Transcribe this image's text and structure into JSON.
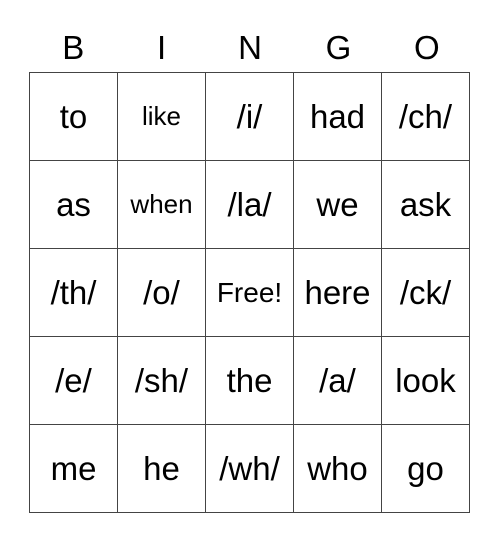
{
  "header": [
    "B",
    "I",
    "N",
    "G",
    "O"
  ],
  "rows": [
    [
      "to",
      "like",
      "/i/",
      "had",
      "/ch/"
    ],
    [
      "as",
      "when",
      "/la/",
      "we",
      "ask"
    ],
    [
      "/th/",
      "/o/",
      "Free!",
      "here",
      "/ck/"
    ],
    [
      "/e/",
      "/sh/",
      "the",
      "/a/",
      "look"
    ],
    [
      "me",
      "he",
      "/wh/",
      "who",
      "go"
    ]
  ]
}
